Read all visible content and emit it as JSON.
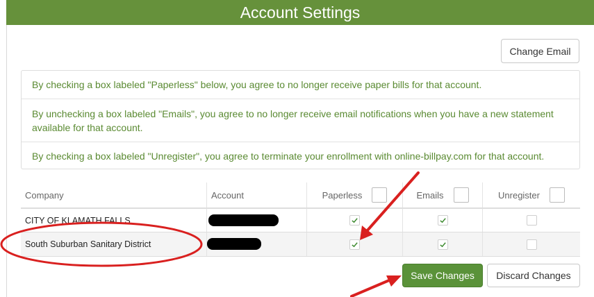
{
  "header": {
    "title": "Account Settings"
  },
  "actions": {
    "change_email": "Change Email",
    "save": "Save Changes",
    "discard": "Discard Changes"
  },
  "notices": [
    "By checking a box labeled \"Paperless\" below, you agree to no longer receive paper bills for that account.",
    "By unchecking a box labeled \"Emails\", you agree to no longer receive email notifications when you have a new statement available for that account.",
    "By checking a box labeled \"Unregister\", you agree to terminate your enrollment with online-billpay.com for that account."
  ],
  "table": {
    "columns": [
      "Company",
      "Account",
      "Paperless",
      "Emails",
      "Unregister"
    ],
    "rows": [
      {
        "company": "CITY OF KLAMATH FALLS",
        "account": "",
        "paperless": true,
        "emails": true,
        "unregister": false
      },
      {
        "company": "South Suburban Sanitary District",
        "account": "",
        "paperless": true,
        "emails": true,
        "unregister": false
      }
    ]
  },
  "colors": {
    "header_bg": "#66913b",
    "notice_text": "#5a8a32",
    "save_bg": "#5a9239",
    "annotation_red": "#d9201f",
    "check_green": "#3c8a2e"
  },
  "icons": {
    "checkmark": "check-icon"
  }
}
